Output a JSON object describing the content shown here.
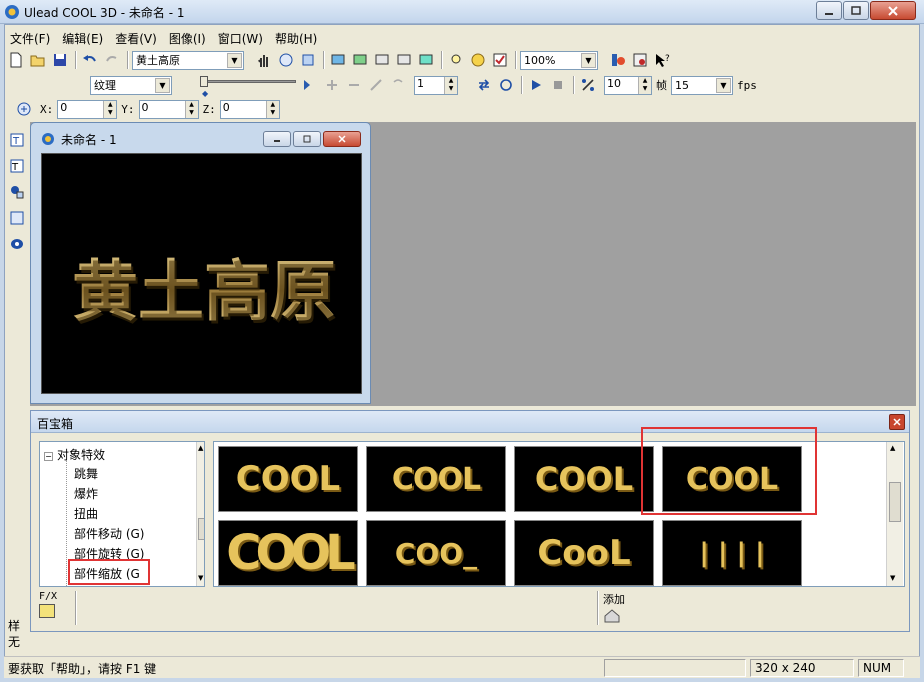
{
  "window": {
    "title": "Ulead COOL 3D - 未命名 - 1"
  },
  "menu": [
    "文件(F)",
    "编辑(E)",
    "查看(V)",
    "图像(I)",
    "窗口(W)",
    "帮助(H)"
  ],
  "toolbar1": {
    "object_combo": "黄土高原",
    "zoom_combo": "100%"
  },
  "toolbar2": {
    "texture_combo": "纹理",
    "frame_value": "1",
    "fps_frames_value": "10",
    "frame_label": "帧",
    "fps_value": "15",
    "fps_label": "fps"
  },
  "toolbar3": {
    "x_label": "X:",
    "x_value": "0",
    "y_label": "Y:",
    "y_value": "0",
    "z_label": "Z:",
    "z_value": "0"
  },
  "child_window": {
    "title": "未命名 - 1",
    "canvas_text": "黄土高原"
  },
  "palette": {
    "title": "百宝箱",
    "tree": {
      "root": "对象特效",
      "items": [
        "跳舞",
        "爆炸",
        "扭曲",
        "部件移动 (G)",
        "部件旋转 (G)",
        "部件缩放 (G"
      ]
    },
    "thumbnails": [
      "COOL",
      "COOL",
      "COOL",
      "COOL",
      "COOL",
      "COO_",
      "CooL",
      "| | | |"
    ],
    "fx_label": "F/X",
    "add_label": "添加"
  },
  "side": {
    "label1": "样",
    "label2": "无"
  },
  "status": {
    "help": "要获取「帮助」，请按 F1 键",
    "size": "320 x 240",
    "num": "NUM"
  }
}
